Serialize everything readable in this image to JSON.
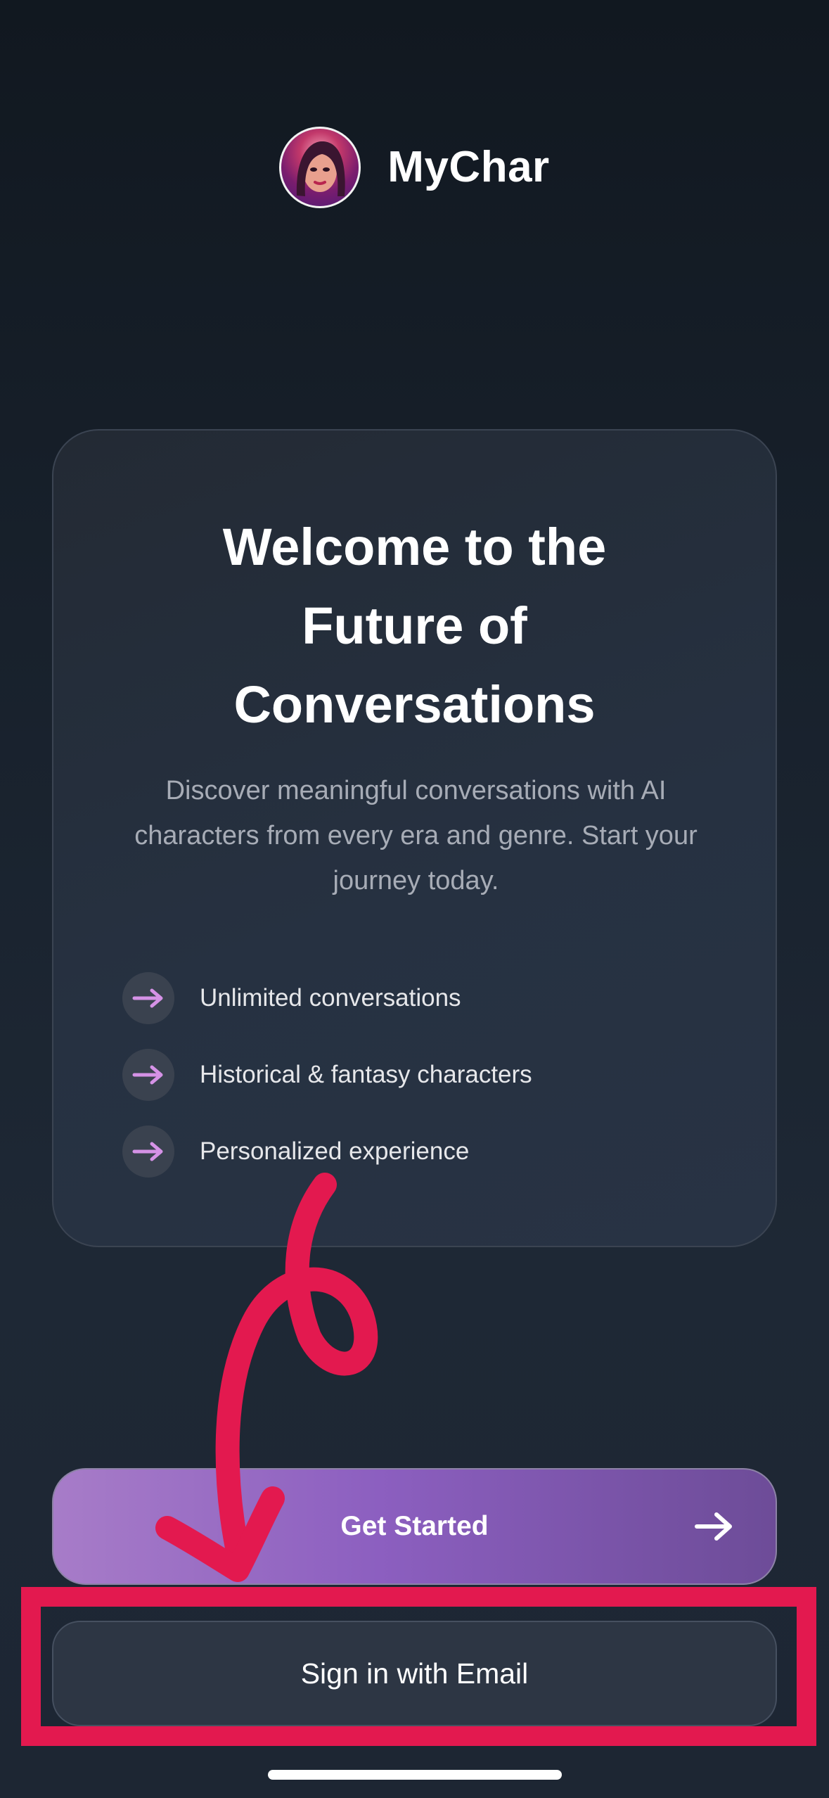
{
  "header": {
    "app_name": "MyChar",
    "avatar_icon": "portrait-avatar-icon"
  },
  "card": {
    "title": "Welcome to the Future of Conversations",
    "description": "Discover meaningful conversations with AI characters from every era and genre. Start your journey today.",
    "features": [
      {
        "icon": "arrow-right-icon",
        "label": "Unlimited conversations"
      },
      {
        "icon": "arrow-right-icon",
        "label": "Historical & fantasy characters"
      },
      {
        "icon": "arrow-right-icon",
        "label": "Personalized experience"
      }
    ]
  },
  "actions": {
    "get_started_label": "Get Started",
    "get_started_icon": "arrow-right-icon",
    "email_signin_label": "Sign in with Email"
  },
  "colors": {
    "accent_start": "#a77cc8",
    "accent_end": "#6d4c98",
    "feature_arrow": "#d592e6",
    "annotation": "#e3194f"
  }
}
